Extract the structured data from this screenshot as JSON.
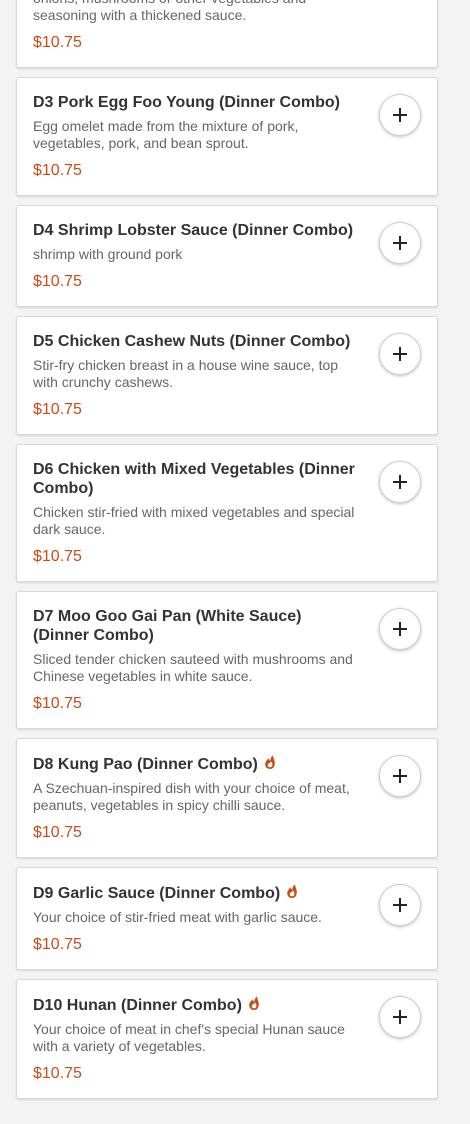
{
  "accent_color": "#cc4b14",
  "spicy_icon": "chili-flame-icon",
  "add_icon": "plus-icon",
  "items": [
    {
      "title": "",
      "desc": "onions, mushrooms or other vegetables and seasoning with a thickened sauce.",
      "price": "$10.75",
      "spicy": false
    },
    {
      "title": "D3 Pork Egg Foo Young (Dinner Combo)",
      "desc": "Egg omelet made from the mixture of pork, vegetables, pork, and bean sprout.",
      "price": "$10.75",
      "spicy": false
    },
    {
      "title": "D4 Shrimp Lobster Sauce (Dinner Combo)",
      "desc": "shrimp with ground pork",
      "price": "$10.75",
      "spicy": false
    },
    {
      "title": "D5 Chicken Cashew Nuts (Dinner Combo)",
      "desc": "Stir-fry chicken breast in a house wine sauce, top with crunchy cashews.",
      "price": "$10.75",
      "spicy": false
    },
    {
      "title": "D6 Chicken with Mixed Vegetables (Dinner Combo)",
      "desc": "Chicken stir-fried with mixed vegetables and special dark sauce.",
      "price": "$10.75",
      "spicy": false
    },
    {
      "title": "D7 Moo Goo Gai Pan (White Sauce) (Dinner Combo)",
      "desc": "Sliced tender chicken sauteed with mushrooms and Chinese vegetables in white sauce.",
      "price": "$10.75",
      "spicy": false
    },
    {
      "title": "D8 Kung Pao (Dinner Combo)",
      "desc": "A Szechuan-inspired dish with your choice of meat, peanuts, vegetables in spicy chilli sauce.",
      "price": "$10.75",
      "spicy": true
    },
    {
      "title": "D9 Garlic Sauce (Dinner Combo)",
      "desc": "Your choice of stir-fried meat with garlic sauce.",
      "price": "$10.75",
      "spicy": true
    },
    {
      "title": "D10 Hunan (Dinner Combo)",
      "desc": "Your choice of meat in chef's special Hunan sauce with a variety of vegetables.",
      "price": "$10.75",
      "spicy": true
    }
  ]
}
